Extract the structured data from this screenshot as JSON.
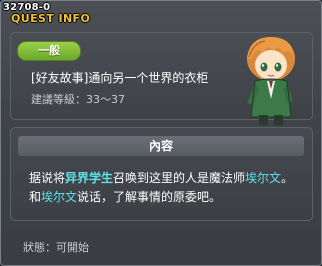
{
  "quest_id": "32708-0",
  "window_title": "QUEST INFO",
  "category_badge": "一般",
  "quest_title": "[好友故事]通向另一个世界的衣柜",
  "recommended_level": "建議等級：33～37",
  "content_header": "內容",
  "description": {
    "line1_a": "据说将",
    "line1_b": "异界学生",
    "line1_c": "召唤到这里的人是魔法师",
    "line1_d": "埃尔文",
    "line1_e": "。",
    "line2_a": "和",
    "line2_b": "埃尔文",
    "line2_c": "说话，了解事情的原委吧。"
  },
  "status_text": "狀態：可開始",
  "npc_icon": "npc-portrait-red-haired-boy",
  "colors": {
    "badge_green": "#8bc34a",
    "title_gold": "#f1c232",
    "highlight_cyan": "#5ee1e8"
  }
}
